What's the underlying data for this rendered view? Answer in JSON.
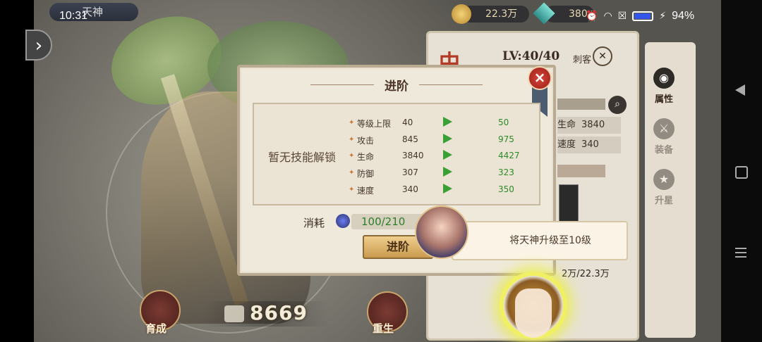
{
  "status_bar": {
    "time": "10:31",
    "battery_pct": "94%",
    "battery_level": 0.94
  },
  "top_bar": {
    "title": "天神",
    "coins": "22.3万",
    "gems": "380"
  },
  "hero": {
    "level": "LV:40/40",
    "class": "刺客"
  },
  "right_panel": {
    "stats": [
      {
        "label": "生命",
        "value": "3840"
      },
      {
        "label": "速度",
        "value": "340"
      }
    ],
    "cost_text": "2万/22.3万"
  },
  "side_tabs": [
    {
      "label": "属性",
      "icon": "attribute-icon"
    },
    {
      "label": "装备",
      "icon": "equipment-icon"
    },
    {
      "label": "升星",
      "icon": "star-up-icon"
    }
  ],
  "bottom": {
    "cultivate_label": "育成",
    "rebirth_label": "重生",
    "power": "8669"
  },
  "modal": {
    "title": "进阶",
    "no_skill_text": "暂无技能解锁",
    "rows": [
      {
        "label": "等级上限",
        "from": "40",
        "to": "50"
      },
      {
        "label": "攻击",
        "from": "845",
        "to": "975"
      },
      {
        "label": "生命",
        "from": "3840",
        "to": "4427"
      },
      {
        "label": "防御",
        "from": "307",
        "to": "323"
      },
      {
        "label": "速度",
        "from": "340",
        "to": "350"
      }
    ],
    "cost_label": "消耗",
    "cost_value": "100/210",
    "button_label": "进阶"
  },
  "tutorial": {
    "tip_text": "将天神升级至10级"
  },
  "colors": {
    "accent_green": "#3aa035",
    "close_red": "#c8352a",
    "glow_yellow": "#f1f062"
  }
}
